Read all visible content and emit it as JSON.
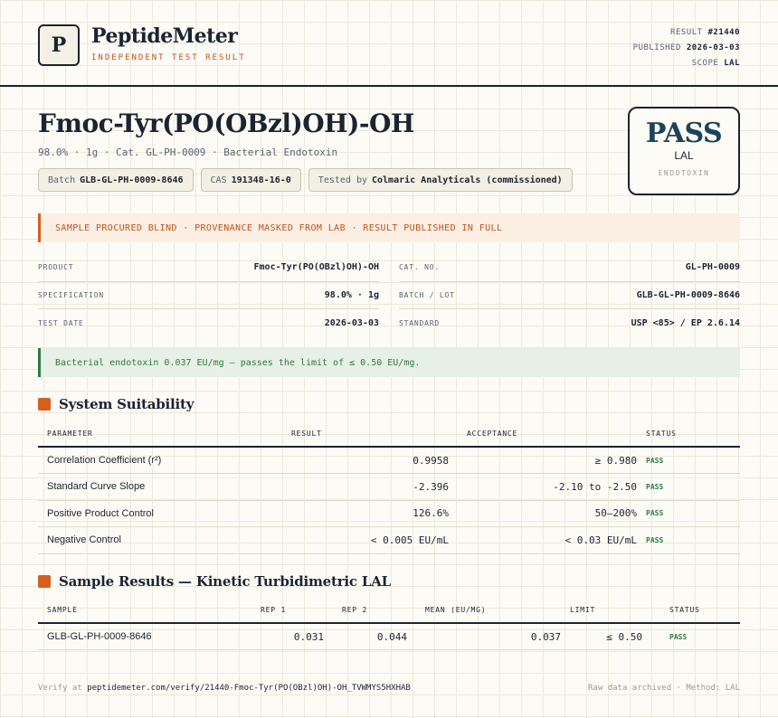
{
  "brand": {
    "logo_letter": "P",
    "name": "PeptideMeter",
    "tagline": "INDEPENDENT TEST RESULT"
  },
  "meta": {
    "result_label": "RESULT",
    "result_value": "#21440",
    "published_label": "PUBLISHED",
    "published_value": "2026-03-03",
    "scope_label": "SCOPE",
    "scope_value": "LAL"
  },
  "title": "Fmoc-Tyr(PO(OBzl)OH)-OH",
  "subtitle": "98.0% · 1g · Cat. GL-PH-0009 · Bacterial Endotoxin",
  "chips": [
    {
      "label": "Batch",
      "value": "GLB-GL-PH-0009-8646"
    },
    {
      "label": "CAS",
      "value": "191348-16-0"
    },
    {
      "label": "Tested by",
      "value": "Colmaric Analyticals (commissioned)"
    }
  ],
  "stamp": {
    "main": "PASS",
    "sub": "LAL",
    "foot": "ENDOTOXIN"
  },
  "notice_warn": "SAMPLE PROCURED BLIND · PROVENANCE MASKED FROM LAB · RESULT PUBLISHED IN FULL",
  "spec_left": [
    {
      "label": "PRODUCT",
      "value": "Fmoc-Tyr(PO(OBzl)OH)-OH"
    },
    {
      "label": "SPECIFICATION",
      "value": "98.0% · 1g"
    },
    {
      "label": "TEST DATE",
      "value": "2026-03-03"
    }
  ],
  "spec_right": [
    {
      "label": "CAT. NO.",
      "value": "GL-PH-0009"
    },
    {
      "label": "BATCH / LOT",
      "value": "GLB-GL-PH-0009-8646"
    },
    {
      "label": "STANDARD",
      "value": "USP <85> / EP 2.6.14"
    }
  ],
  "notice_ok": "Bacterial endotoxin 0.037 EU/mg — passes the limit of ≤ 0.50 EU/mg.",
  "suitability": {
    "heading": "System Suitability",
    "headers": [
      "PARAMETER",
      "RESULT",
      "ACCEPTANCE",
      "STATUS"
    ],
    "rows": [
      {
        "param": "Correlation Coefficient (r²)",
        "result": "0.9958",
        "acceptance": "≥ 0.980",
        "status": "PASS"
      },
      {
        "param": "Standard Curve Slope",
        "result": "-2.396",
        "acceptance": "-2.10 to -2.50",
        "status": "PASS"
      },
      {
        "param": "Positive Product Control",
        "result": "126.6%",
        "acceptance": "50–200%",
        "status": "PASS"
      },
      {
        "param": "Negative Control",
        "result": "< 0.005 EU/mL",
        "acceptance": "< 0.03 EU/mL",
        "status": "PASS"
      }
    ]
  },
  "samples": {
    "heading": "Sample Results — Kinetic Turbidimetric LAL",
    "headers": [
      "SAMPLE",
      "REP 1",
      "REP 2",
      "MEAN (EU/MG)",
      "LIMIT",
      "STATUS"
    ],
    "rows": [
      {
        "sample": "GLB-GL-PH-0009-8646",
        "rep1": "0.031",
        "rep2": "0.044",
        "mean": "0.037",
        "limit": "≤ 0.50",
        "status": "PASS"
      }
    ]
  },
  "footer": {
    "verify_prefix": "Verify at",
    "verify_url": "peptidemeter.com/verify/21440-Fmoc-Tyr(PO(OBzl)OH)-OH_TVWMYS5HXHAB",
    "right": "Raw data archived · Method: LAL"
  },
  "colors": {
    "accent": "#d45f1e",
    "pass": "#2e7a45",
    "ink": "#1b2430",
    "stamp": "#1d4358"
  }
}
